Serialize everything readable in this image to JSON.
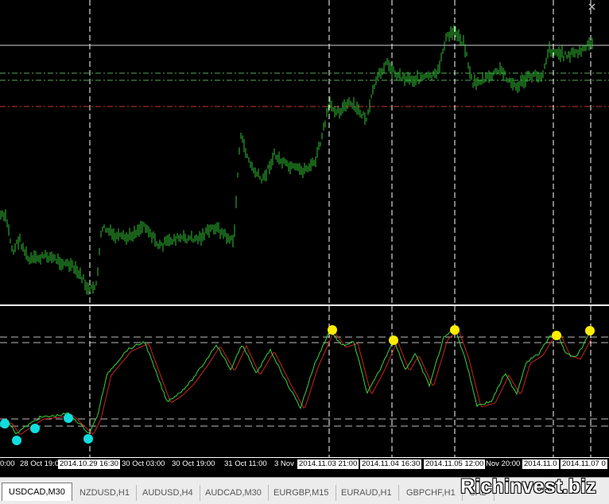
{
  "colors": {
    "background": "#000000",
    "candles": "#2fbf33",
    "osc_main": "#39d43a",
    "osc_signal": "#cc2222",
    "overbought_dot": "#ffee00",
    "oversold_dot": "#11dddd",
    "green_level": "#58a858",
    "red_level": "#cc3333",
    "grid": "#ffffff"
  },
  "time_axis": {
    "labels": [
      "0:00",
      "28 Oct 19:00",
      "2014.10.29 16:30",
      "30 Oct 03:00",
      "30 Oct 19:00",
      "31 Oct 11:00",
      "3 Nov",
      "2014.11.03 21:00",
      "2014.11.04 16:30",
      "2014.11.05 12:00",
      "Nov 20:00",
      "2014.11.0",
      "2014.11.07 0"
    ]
  },
  "tabs": [
    {
      "label": "USDCAD,M30",
      "active": true
    },
    {
      "label": "NZDUSD,H1",
      "active": false
    },
    {
      "label": "AUDUSD,H4",
      "active": false
    },
    {
      "label": "AUDCAD,M30",
      "active": false
    },
    {
      "label": "EURGBP,M15",
      "active": false
    },
    {
      "label": "EURAUD,H1",
      "active": false
    },
    {
      "label": "GBPCHF,H1",
      "active": false
    },
    {
      "label": "CAD",
      "active": false
    }
  ],
  "watermark": "Richinvest.biz",
  "icons": {
    "corner": "x-close-icon"
  }
}
